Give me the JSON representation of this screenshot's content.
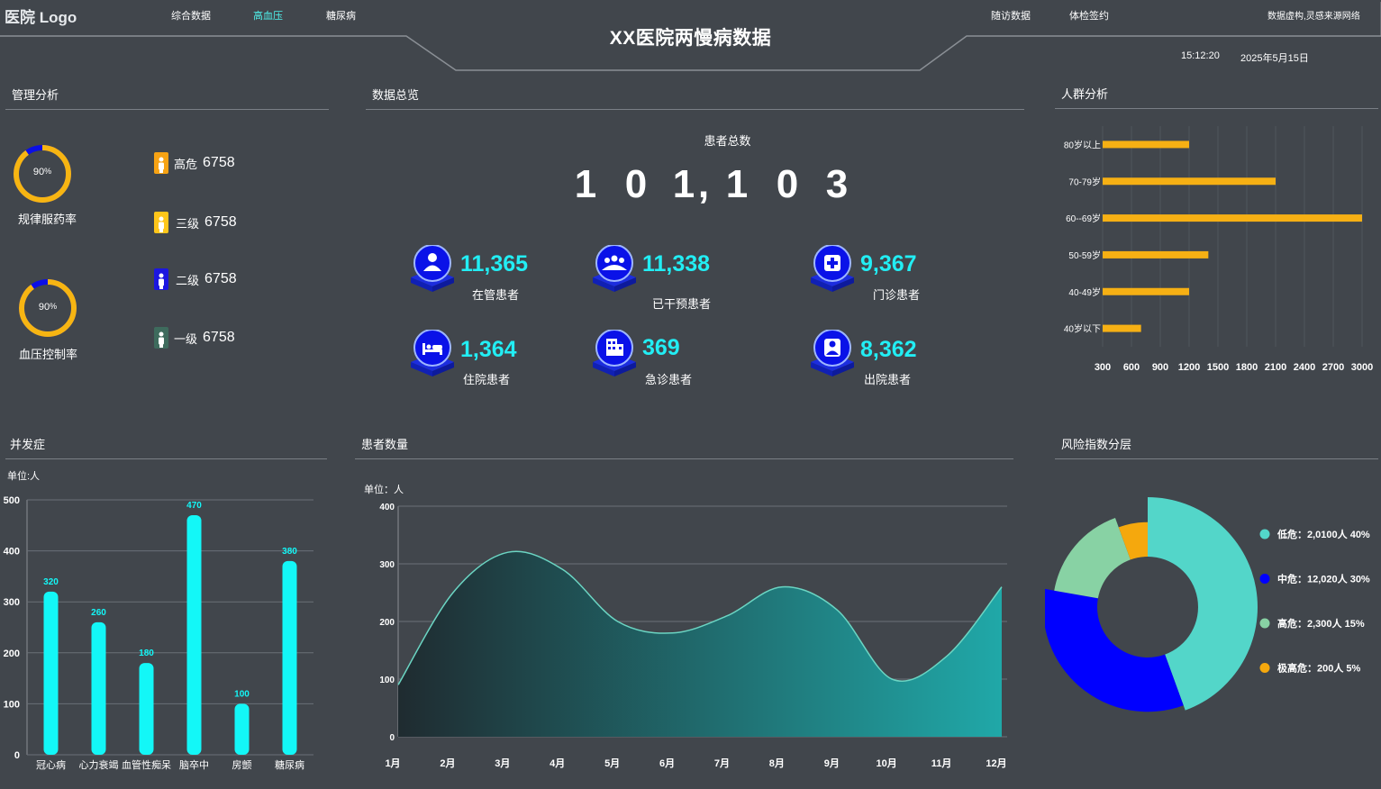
{
  "header": {
    "logo": "医院 Logo",
    "title": "XX医院两慢病数据",
    "nav_left": [
      "综合数据",
      "高血压",
      "糖尿病"
    ],
    "nav_right": [
      "随访数据",
      "体检签约"
    ],
    "disclaimer": "数据虚构,灵感来源网络",
    "time": "15:12:20",
    "date": "2025年5月15日",
    "active_color": "#4ff4ee"
  },
  "management": {
    "title": "管理分析",
    "rings": [
      {
        "percent_label": "90",
        "percent_sign": "%",
        "label": "规律服药率",
        "value": 0.9
      },
      {
        "percent_label": "90",
        "percent_sign": "%",
        "label": "血压控制率",
        "value": 0.9
      }
    ],
    "risk_levels": [
      {
        "label": "高危",
        "value": "6758",
        "color": "#f7a314"
      },
      {
        "label": "三级",
        "value": "6758",
        "color": "#ffc61a"
      },
      {
        "label": "二级",
        "value": "6758",
        "color": "#1c17e0"
      },
      {
        "label": "一级",
        "value": "6758",
        "color": "#3e6b5d"
      }
    ]
  },
  "overview": {
    "title": "数据总览",
    "total_label": "患者总数",
    "total_digits": [
      "1",
      "0",
      "1",
      ",",
      "1",
      "0",
      "3"
    ],
    "stats": [
      {
        "value": "11,365",
        "label": "在管患者",
        "icon": "patient-icon"
      },
      {
        "value": "11,338",
        "label": "已干预患者",
        "icon": "group-icon"
      },
      {
        "value": "9,367",
        "label": "门诊患者",
        "icon": "first-aid-icon"
      },
      {
        "value": "1,364",
        "label": "住院患者",
        "icon": "bed-icon"
      },
      {
        "value": "369",
        "label": "急诊患者",
        "icon": "hospital-building-icon"
      },
      {
        "value": "8,362",
        "label": "出院患者",
        "icon": "discharge-patient-icon"
      }
    ]
  },
  "population": {
    "title": "人群分析",
    "chart_data": {
      "type": "bar",
      "orientation": "horizontal",
      "categories": [
        "80岁以上",
        "70-79岁",
        "60--69岁",
        "50-59岁",
        "40-49岁",
        "40岁以下"
      ],
      "values": [
        1200,
        2100,
        3000,
        1400,
        1200,
        700
      ],
      "xticks": [
        "300",
        "600",
        "900",
        "1200",
        "1500",
        "1800",
        "2100",
        "2400",
        "2700",
        "3000"
      ],
      "xlim": [
        300,
        3000
      ],
      "color": "#f6b014",
      "grid": true
    }
  },
  "complications": {
    "title": "并发症",
    "unit": "单位:人",
    "chart_data": {
      "type": "bar",
      "categories": [
        "冠心病",
        "心力衰竭",
        "血管性痴呆",
        "脑卒中",
        "房颤",
        "糖尿病"
      ],
      "values": [
        320,
        260,
        180,
        470,
        100,
        380
      ],
      "yticks": [
        "0",
        "100",
        "200",
        "300",
        "400",
        "500"
      ],
      "ylim": [
        0,
        500
      ],
      "color": "#13f7f7",
      "grid": true
    }
  },
  "patients": {
    "title": "患者数量",
    "unit": "单位：人",
    "chart_data": {
      "type": "area",
      "categories": [
        "1月",
        "2月",
        "3月",
        "4月",
        "5月",
        "6月",
        "7月",
        "8月",
        "9月",
        "10月",
        "11月",
        "12月"
      ],
      "values": [
        90,
        250,
        320,
        290,
        200,
        180,
        210,
        260,
        220,
        100,
        140,
        260
      ],
      "yticks": [
        "0",
        "100",
        "200",
        "300",
        "400"
      ],
      "ylim": [
        0,
        400
      ],
      "line_color": "#6bd5c3",
      "fill_from": "#1f2b30",
      "fill_to": "#20a8a8",
      "grid": true
    }
  },
  "risk": {
    "title": "风险指数分层",
    "chart_data": {
      "type": "pie",
      "style": "rose-donut",
      "series": [
        {
          "name": "低危",
          "detail": "2,0100人",
          "percent": "40%",
          "value": 40,
          "color": "#53d6c9"
        },
        {
          "name": "中危",
          "detail": "12,020人",
          "percent": "30%",
          "value": 30,
          "color": "#0000ff"
        },
        {
          "name": "高危",
          "detail": "2,300人",
          "percent": "15%",
          "value": 15,
          "color": "#88d2a4"
        },
        {
          "name": "极高危",
          "detail": "200人",
          "percent": "5%",
          "value": 5,
          "color": "#f5a80d"
        }
      ],
      "legend_position": "right"
    }
  }
}
